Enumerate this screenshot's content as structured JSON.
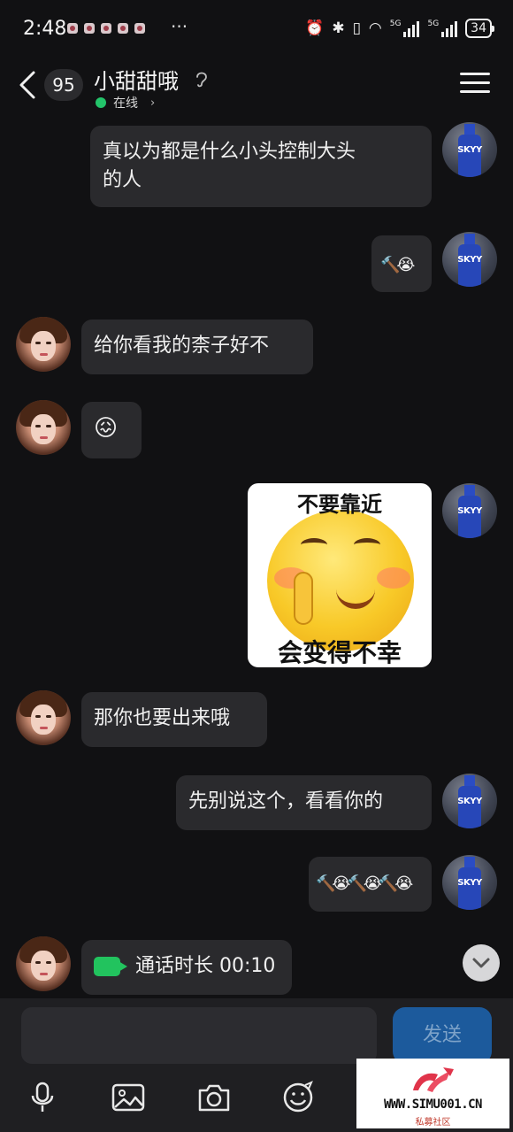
{
  "status_bar": {
    "time": "2:48",
    "more": "···",
    "battery": "34",
    "signal_label_1": "5G",
    "signal_label_2": "5G"
  },
  "header": {
    "unread_count": "95",
    "contact_name": "小甜甜哦",
    "status": "在线"
  },
  "messages": [
    {
      "side": "me",
      "type": "text",
      "text_line1": "真以为都是什么小头控制大头",
      "text_line2": "的人"
    },
    {
      "side": "me",
      "type": "emoji",
      "text": "🔨😭"
    },
    {
      "side": "her",
      "type": "text",
      "text": "给你看我的柰子好不"
    },
    {
      "side": "her",
      "type": "emoji",
      "text": "😖"
    },
    {
      "side": "me",
      "type": "sticker",
      "sticker_top": "不要靠近",
      "sticker_bottom": "会变得不幸"
    },
    {
      "side": "her",
      "type": "text",
      "text": "那你也要出来哦"
    },
    {
      "side": "me",
      "type": "text",
      "text": "先别说这个，看看你的"
    },
    {
      "side": "me",
      "type": "emoji",
      "text": "🔨😭🔨😭🔨😭"
    },
    {
      "side": "her",
      "type": "call",
      "text": "通话时长 00:10"
    }
  ],
  "avatar_me_brand": "SKYY",
  "composer": {
    "input_value": "",
    "send_label": "发送"
  },
  "watermark": {
    "url": "WWW.SIMU001.CN",
    "sub": "私募社区"
  },
  "colors": {
    "background": "#111113",
    "bubble": "#2a2a2d",
    "online": "#23c46a",
    "call_icon": "#22c35e",
    "send_button": "#1c5a9c"
  }
}
